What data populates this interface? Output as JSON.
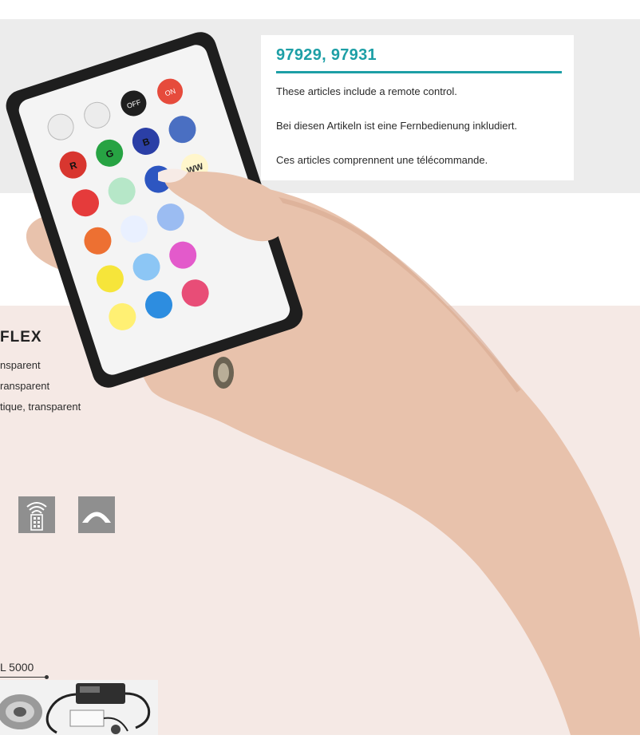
{
  "info_box": {
    "title": "97929, 97931",
    "lines": [
      "These articles include a remote control.",
      "Bei diesen Artikeln ist eine Fernbedienung inkludiert.",
      "Ces articles comprennent une télécommande."
    ]
  },
  "flex": {
    "title": "FLEX",
    "lines": [
      "nsparent",
      "ransparent",
      "tique, transparent"
    ]
  },
  "remote": {
    "row1": [
      "OFF",
      "ON"
    ],
    "row2": [
      "R",
      "G",
      "B"
    ],
    "row3": [
      "WW"
    ]
  },
  "icons": [
    "remote-control-icon",
    "dimmer-icon"
  ],
  "length_label": "L 5000",
  "colors": {
    "accent": "#1d9fa6",
    "gray_band": "#ececec",
    "pink_band": "#f5e9e5",
    "icon_bg": "#8f8f8f"
  }
}
